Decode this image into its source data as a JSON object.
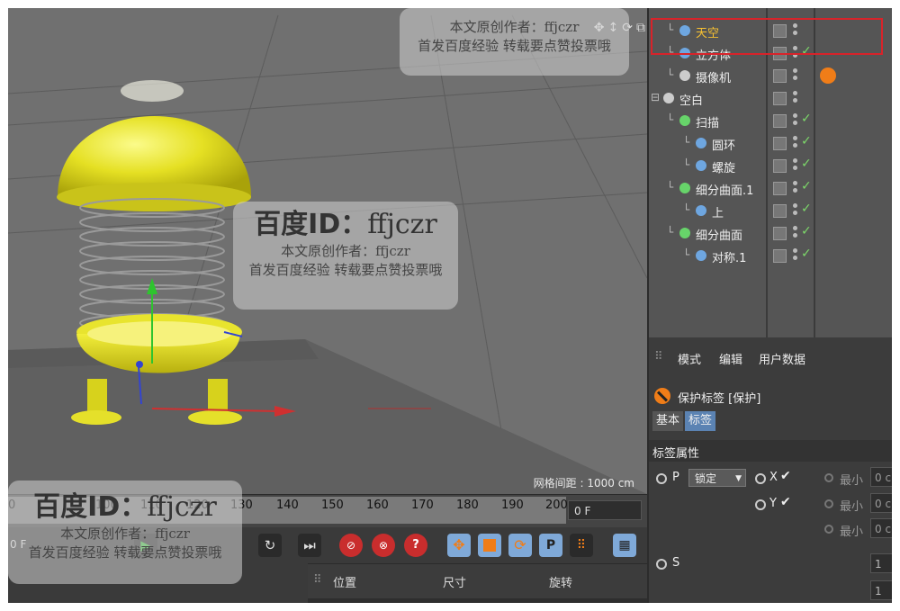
{
  "viewport": {
    "grid_spacing": "网格间距 : 1000 cm"
  },
  "watermark": {
    "brand_prefix": "百度ID：",
    "brand_id": "ffjczr",
    "author_line": "本文原创作者：ffjczr",
    "publish_line": "首发百度经验 转载要点赞投票哦",
    "top_author_line": "本文原创作者：ffjczr",
    "top_publish_line": "首发百度经验 转载要点赞投票哦",
    "bl_author_line": "本文原创作者：ffjczr",
    "bl_publish_line": "首发百度经验 转载要点赞投票哦"
  },
  "timeline": {
    "ticks": [
      "0",
      "100",
      "110",
      "120",
      "130",
      "140",
      "150",
      "160",
      "170",
      "180",
      "190",
      "200"
    ],
    "current_frame": "0 F",
    "start_frame": "0 F"
  },
  "objects": [
    {
      "name": "天空",
      "indent": 1,
      "selected": true,
      "icon": "sky-icon"
    },
    {
      "name": "立方体",
      "indent": 1,
      "selected": false,
      "icon": "cube-icon"
    },
    {
      "name": "摄像机",
      "indent": 1,
      "selected": false,
      "icon": "camera-icon"
    },
    {
      "name": "空白",
      "indent": 0,
      "selected": false,
      "icon": "null-icon"
    },
    {
      "name": "扫描",
      "indent": 1,
      "selected": false,
      "icon": "sweep-icon"
    },
    {
      "name": "圆环",
      "indent": 2,
      "selected": false,
      "icon": "circle-spline-icon"
    },
    {
      "name": "螺旋",
      "indent": 2,
      "selected": false,
      "icon": "helix-icon"
    },
    {
      "name": "细分曲面.1",
      "indent": 1,
      "selected": false,
      "icon": "subdivision-icon"
    },
    {
      "name": "上",
      "indent": 2,
      "selected": false,
      "icon": "polygon-object-icon"
    },
    {
      "name": "细分曲面",
      "indent": 1,
      "selected": false,
      "icon": "subdivision-icon"
    },
    {
      "name": "对称.1",
      "indent": 2,
      "selected": false,
      "icon": "symmetry-icon"
    }
  ],
  "attributes": {
    "menu": [
      "模式",
      "编辑",
      "用户数据"
    ],
    "tag_title": "保护标签 [保护]",
    "tabs": [
      "基本",
      "标签"
    ],
    "active_tab": "标签",
    "section": "标签属性",
    "p_label": "P",
    "p_mode": "锁定",
    "x_label": "X",
    "y_label": "Y",
    "min_label": "最小",
    "min_value": "0 c",
    "s_label": "S",
    "s_value": "1"
  },
  "coords": {
    "position": "位置",
    "size": "尺寸",
    "rotation": "旋转"
  },
  "colors": {
    "accent_selected": "#f7c132",
    "highlight_box": "#d8232a",
    "active_tab": "#5b83b3",
    "orange_tool": "#f07d18",
    "red_tool": "#c92d2d"
  }
}
